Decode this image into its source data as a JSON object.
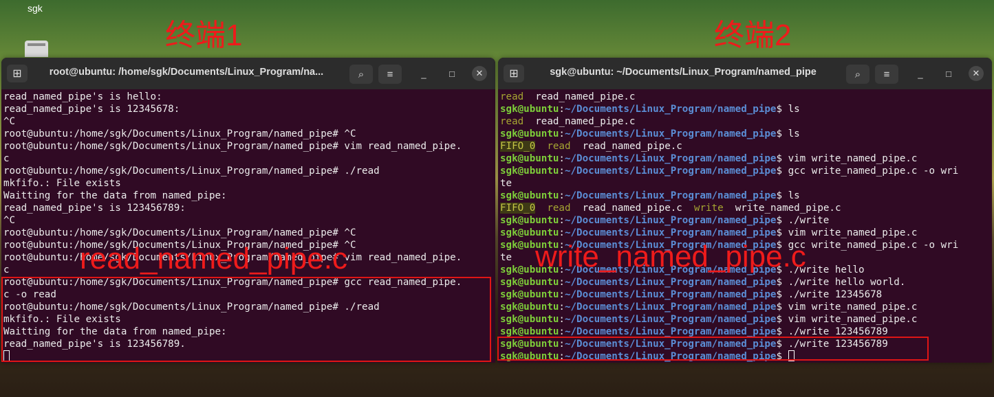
{
  "desktop": {
    "icon_label": "sgk"
  },
  "annotations": {
    "terminal1_label": "终端1",
    "terminal2_label": "终端2",
    "terminal1_file": "read_named_pipe.c",
    "terminal2_file": "write_named_pipe.c"
  },
  "terminal1": {
    "title": "root@ubuntu: /home/sgk/Documents/Linux_Program/na...",
    "lines": [
      "read_named_pipe's is hello:",
      "read_named_pipe's is 12345678:",
      "^C",
      "root@ubuntu:/home/sgk/Documents/Linux_Program/named_pipe# ^C",
      "root@ubuntu:/home/sgk/Documents/Linux_Program/named_pipe# vim read_named_pipe.",
      "c",
      "root@ubuntu:/home/sgk/Documents/Linux_Program/named_pipe# ./read",
      "mkfifo.: File exists",
      "Waitting for the data from named_pipe:",
      "read_named_pipe's is 123456789:",
      "^C",
      "root@ubuntu:/home/sgk/Documents/Linux_Program/named_pipe# ^C",
      "root@ubuntu:/home/sgk/Documents/Linux_Program/named_pipe# ^C",
      "root@ubuntu:/home/sgk/Documents/Linux_Program/named_pipe# vim read_named_pipe.",
      "c",
      "root@ubuntu:/home/sgk/Documents/Linux_Program/named_pipe# gcc read_named_pipe.",
      "c -o read",
      "root@ubuntu:/home/sgk/Documents/Linux_Program/named_pipe# ./read",
      "mkfifo.: File exists",
      "Waitting for the data from named_pipe:",
      "read_named_pipe's is 123456789."
    ]
  },
  "terminal2": {
    "title": "sgk@ubuntu: ~/Documents/Linux_Program/named_pipe",
    "user": "sgk@ubuntu",
    "colon": ":",
    "path": "~/Documents/Linux_Program/named_pipe",
    "dollar": "$ ",
    "top_listing": {
      "read": "read",
      "file": "  read_named_pipe.c"
    },
    "commands": [
      "ls",
      "ls",
      "vim write_named_pipe.c",
      "gcc write_named_pipe.c -o wri",
      "ls",
      "./write",
      "vim write_named_pipe.c",
      "gcc write_named_pipe.c -o wri",
      "./write hello",
      "./write hello world.",
      "./write 12345678",
      "vim write_named_pipe.c",
      "vim write_named_pipe.c",
      "./write 123456789",
      "./write 123456789",
      ""
    ],
    "out_ls1": {
      "read": "read",
      "file": "  read_named_pipe.c"
    },
    "out_ls2": {
      "fifo": "FIFO_0",
      "read": "read",
      "file": "read_named_pipe.c"
    },
    "wrap_te": "te",
    "out_ls3": {
      "fifo": "FIFO_0",
      "read": "read",
      "file": "read_named_pipe.c",
      "write": "write",
      "file2": "write_named_pipe.c"
    }
  }
}
